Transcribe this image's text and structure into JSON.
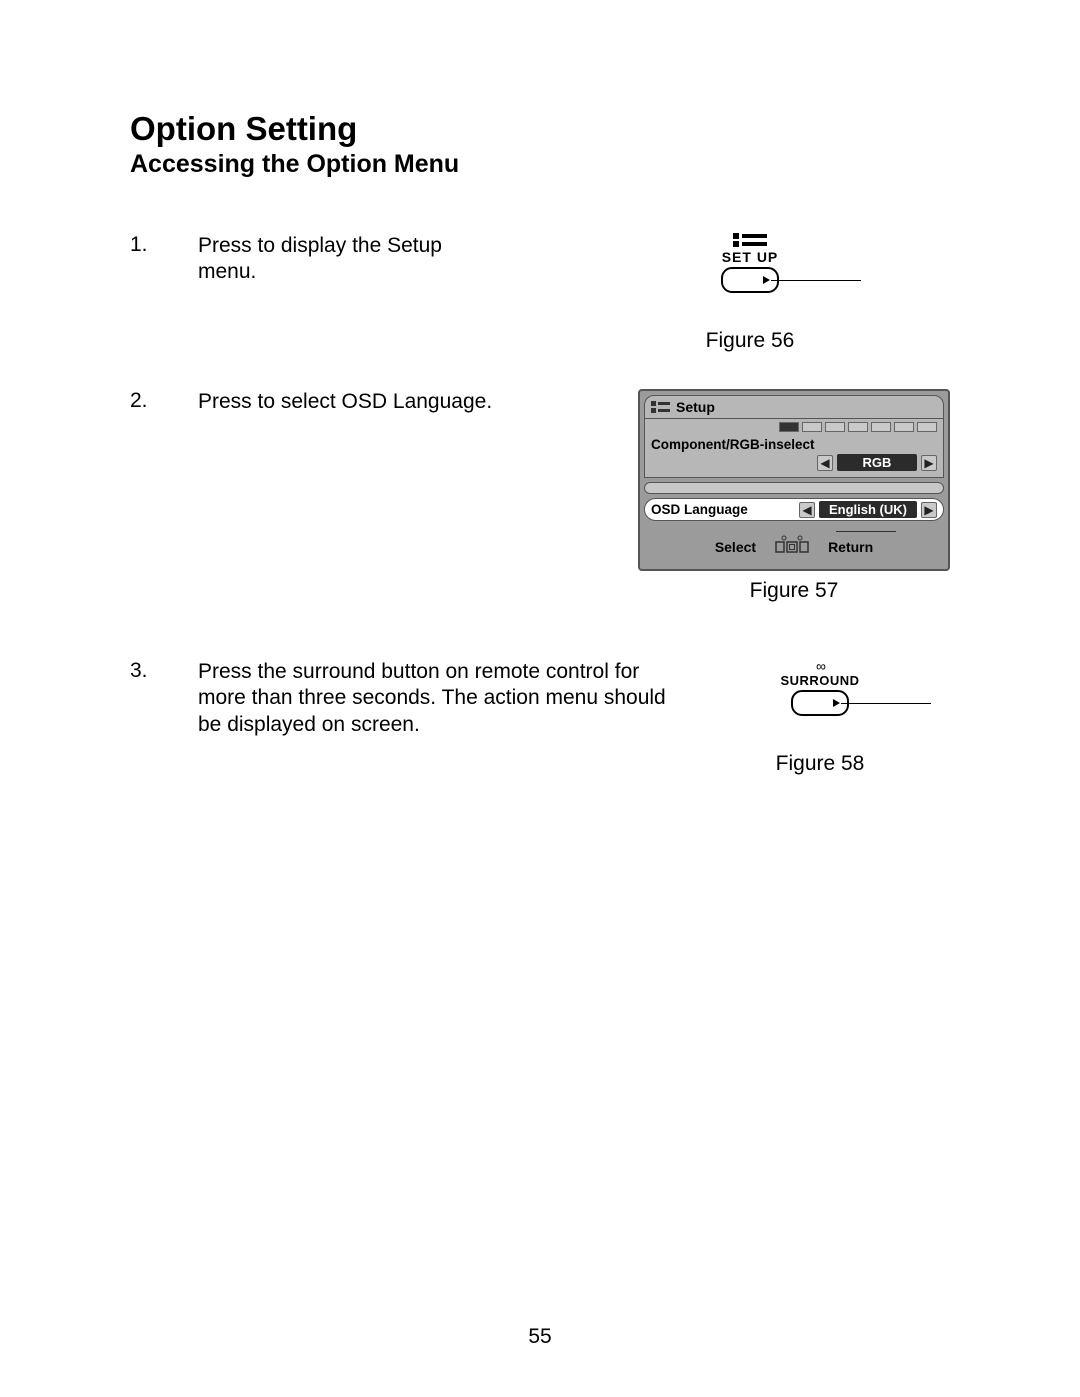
{
  "title": "Option Setting",
  "subtitle": "Accessing the Option Menu",
  "steps": [
    {
      "num": "1.",
      "text": "Press to display the Setup menu."
    },
    {
      "num": "2.",
      "text": "Press to select OSD Language."
    },
    {
      "num": "3.",
      "text": "Press the surround button on remote control for more than three seconds. The action menu should be displayed on screen."
    }
  ],
  "figures": {
    "f56": {
      "caption": "Figure 56",
      "button_label": "SET UP"
    },
    "f57": {
      "caption": "Figure 57",
      "header": "Setup",
      "row1_label": "Component/RGB-inselect",
      "row1_value": "RGB",
      "row2_label": "OSD Language",
      "row2_value": "English (UK)",
      "nav_select": "Select",
      "nav_return": "Return"
    },
    "f58": {
      "caption": "Figure 58",
      "button_label": "SURROUND"
    }
  },
  "page_number": "55"
}
